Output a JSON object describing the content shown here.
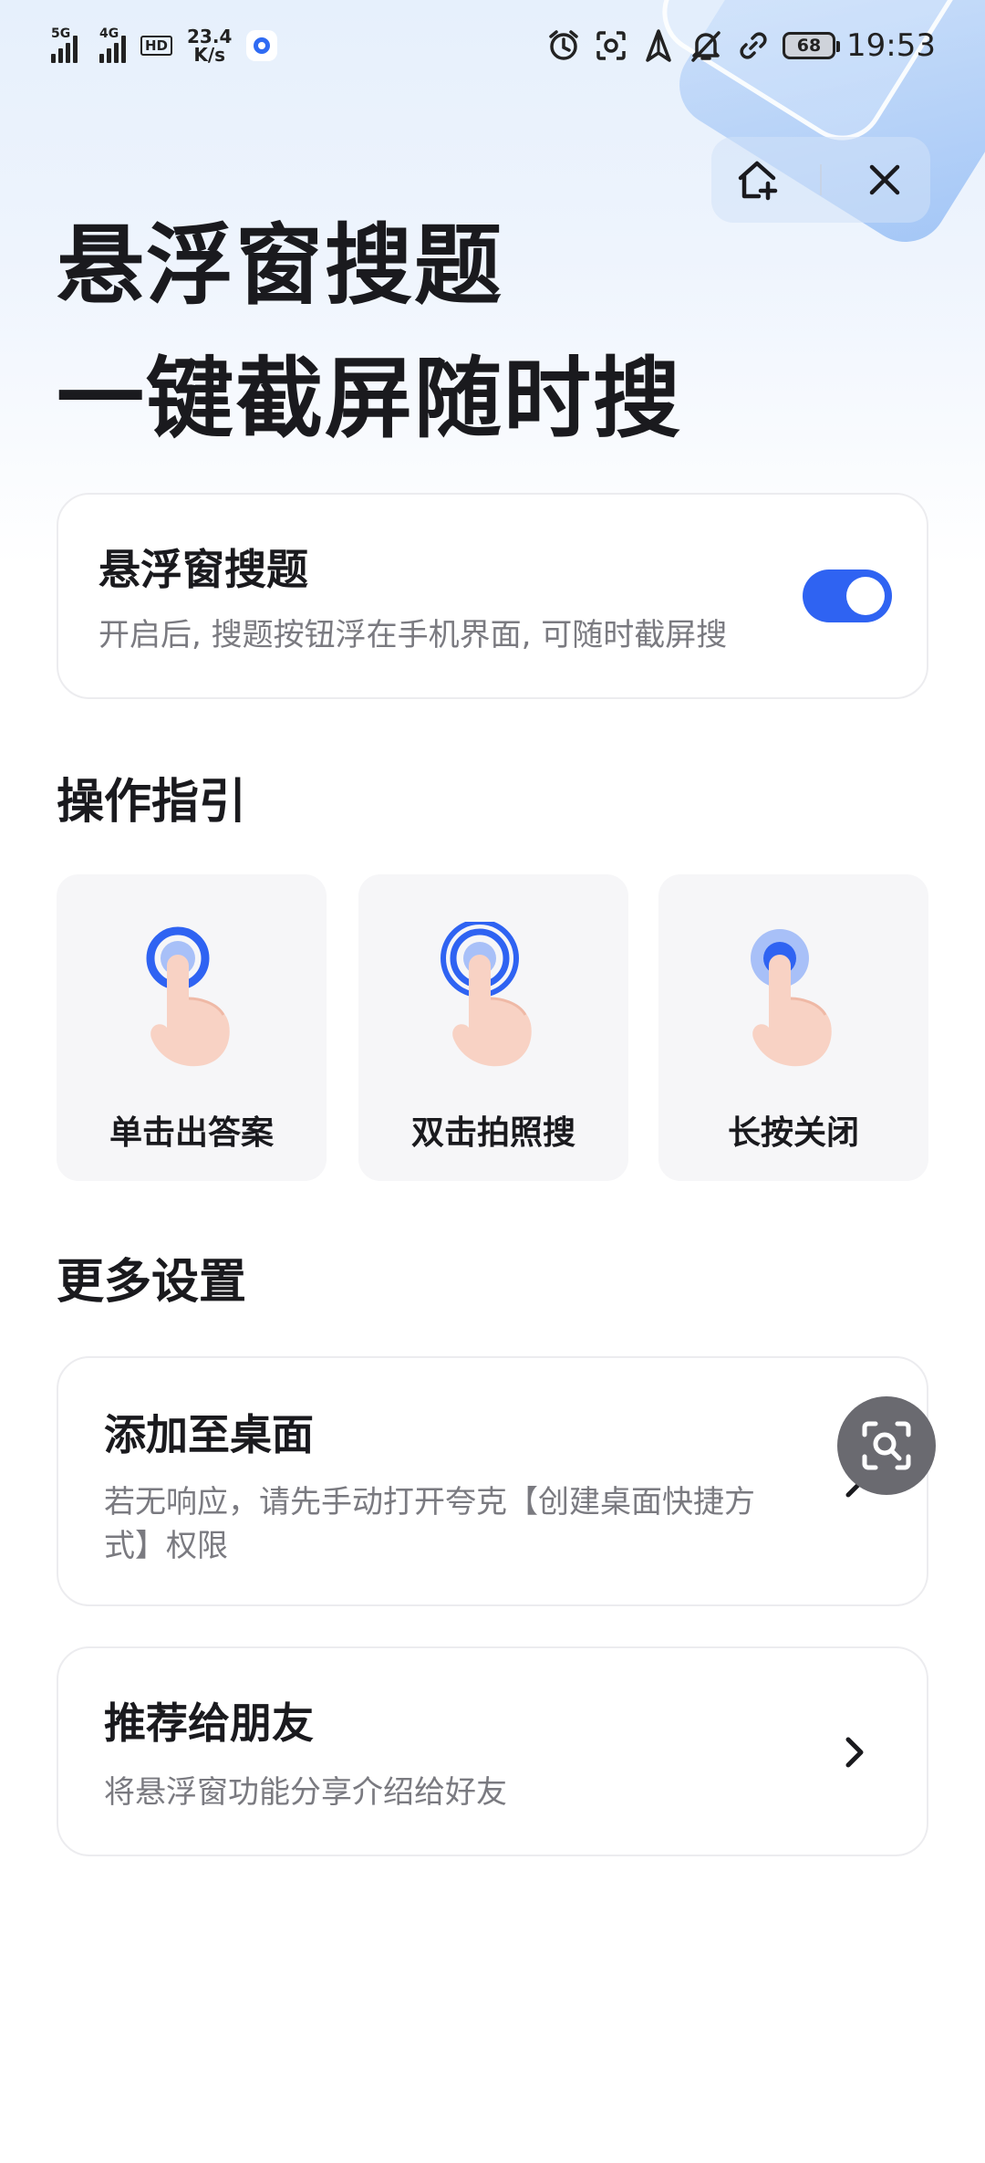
{
  "status_bar": {
    "signal1_label": "5G",
    "signal2_label": "4G",
    "hd_label": "HD",
    "net_speed_value": "23.4",
    "net_speed_unit": "K/s",
    "battery": "68",
    "time": "19:53"
  },
  "top_pill": {
    "add_icon": "add-to-home-icon",
    "close_icon": "close-icon"
  },
  "hero": {
    "line1": "悬浮窗搜题",
    "line2": "一键截屏随时搜"
  },
  "toggle_card": {
    "title": "悬浮窗搜题",
    "description": "开启后, 搜题按钮浮在手机界面, 可随时截屏搜",
    "enabled": true
  },
  "guide": {
    "title": "操作指引",
    "items": [
      {
        "label": "单击出答案",
        "icon": "tap-hand-icon"
      },
      {
        "label": "双击拍照搜",
        "icon": "double-tap-hand-icon"
      },
      {
        "label": "长按关闭",
        "icon": "long-press-hand-icon"
      }
    ]
  },
  "more_settings": {
    "title": "更多设置",
    "items": [
      {
        "title": "添加至桌面",
        "description_line1": "若无响应，请先手动打开夸克【创建桌面快捷方",
        "description_line2": "式】权限"
      },
      {
        "title": "推荐给朋友",
        "description_line1": "将悬浮窗功能分享介绍给好友"
      }
    ]
  },
  "floating_button": {
    "icon": "screenshot-search-icon"
  },
  "colors": {
    "accent": "#2f63f2",
    "text_primary": "#1a1a1e",
    "text_secondary": "#7a7a80",
    "card_border": "#ececef"
  }
}
